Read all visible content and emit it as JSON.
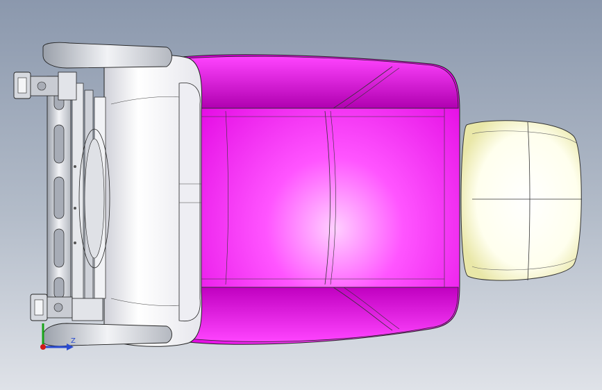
{
  "viewport": {
    "background_top": "#8b98ad",
    "background_bottom": "#dfe2e8"
  },
  "colors": {
    "seat_cushion": "#ff33ff",
    "seat_shadow": "#c000c0",
    "headrest": "#fdfcd8",
    "backrest": "#f4f4f6",
    "frame": "#d0d3da",
    "edge_lines": "#222222"
  },
  "triad": {
    "z_label": "Z",
    "icons": [
      "x-axis-icon",
      "y-axis-icon",
      "z-axis-icon"
    ]
  }
}
